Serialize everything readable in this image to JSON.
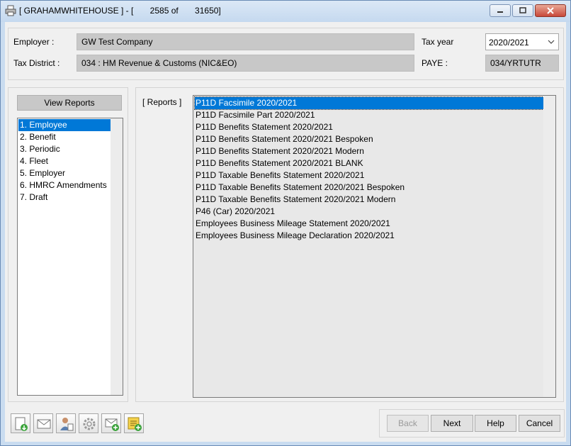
{
  "window": {
    "title": "[ GRAHAMWHITEHOUSE ] - [       2585 of       31650]"
  },
  "header": {
    "employer_label": "Employer :",
    "employer_value": "GW Test Company",
    "tax_district_label": "Tax District :",
    "tax_district_value": "034 : HM Revenue & Customs (NIC&EO)",
    "tax_year_label": "Tax year",
    "tax_year_value": "2020/2021",
    "paye_label": "PAYE :",
    "paye_value": "034/YRTUTR"
  },
  "sidebar": {
    "view_reports_label": "View Reports",
    "items": [
      {
        "label": "1. Employee"
      },
      {
        "label": "2. Benefit"
      },
      {
        "label": "3. Periodic"
      },
      {
        "label": "4. Fleet"
      },
      {
        "label": "5. Employer"
      },
      {
        "label": "6. HMRC Amendments"
      },
      {
        "label": "7. Draft"
      }
    ],
    "selected_index": 0
  },
  "reports": {
    "label": "[ Reports ]",
    "items": [
      "P11D Facsimile 2020/2021",
      "P11D Facsimile Part 2020/2021",
      "P11D Benefits Statement 2020/2021",
      "P11D Benefits Statement 2020/2021 Bespoken",
      "P11D Benefits Statement 2020/2021 Modern",
      "P11D Benefits Statement 2020/2021 BLANK",
      "P11D Taxable Benefits Statement 2020/2021",
      "P11D Taxable Benefits Statement 2020/2021 Bespoken",
      "P11D Taxable Benefits Statement 2020/2021 Modern",
      "P46 (Car) 2020/2021",
      "Employees Business Mileage Statement 2020/2021",
      "Employees Business Mileage Declaration 2020/2021"
    ],
    "selected_index": 0
  },
  "toolbar": {
    "icons": [
      "document-download-icon",
      "mail-icon",
      "user-report-icon",
      "gear-icon",
      "mail-add-icon",
      "note-add-icon"
    ]
  },
  "footer": {
    "back_label": "Back",
    "next_label": "Next",
    "help_label": "Help",
    "cancel_label": "Cancel"
  },
  "colors": {
    "selection": "#0078d7",
    "readonly_field": "#c8c8c8",
    "window_frame": "#c9dcf0"
  }
}
